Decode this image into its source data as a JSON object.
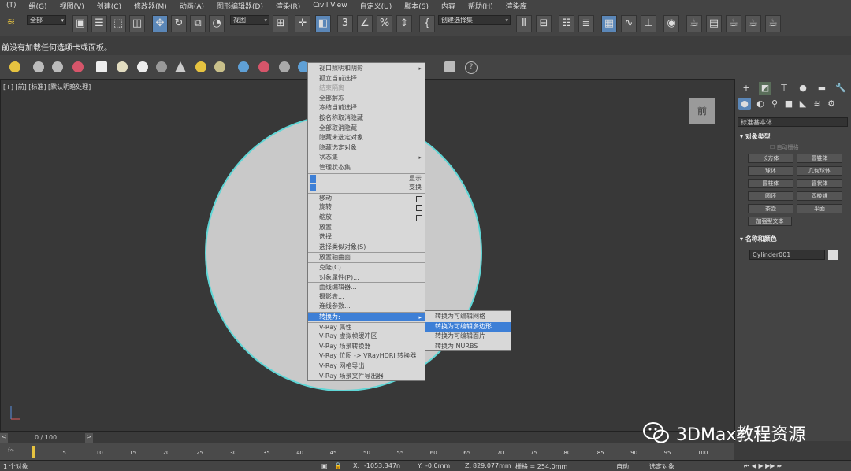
{
  "menubar": [
    "(T)",
    "组(G)",
    "视图(V)",
    "创建(C)",
    "修改器(M)",
    "动画(A)",
    "图形编辑器(D)",
    "渲染(R)",
    "Civil View",
    "自定义(U)",
    "脚本(S)",
    "内容",
    "帮助(H)",
    "渲染库"
  ],
  "toolbar": {
    "selection_filter": "全部",
    "ref_coord": "视图",
    "named_selection": "创建选择集"
  },
  "infobar": {
    "message": "前没有加载任何选项卡或面板。"
  },
  "viewport": {
    "label": "[+] [前] [标准] [默认明暗处理]",
    "viewcube_label": "前"
  },
  "context_menu": {
    "items": [
      {
        "label": "视口照明和阴影",
        "arrow": "▸"
      },
      {
        "label": "孤立当前选择"
      },
      {
        "label": "结束隔离",
        "dim": true
      },
      {
        "label": "全部解冻"
      },
      {
        "label": "冻结当前选择"
      },
      {
        "label": "按名称取消隐藏"
      },
      {
        "label": "全部取消隐藏"
      },
      {
        "label": "隐藏未选定对象"
      },
      {
        "label": "隐藏选定对象"
      },
      {
        "label": "状态集",
        "arrow": "▸"
      },
      {
        "label": "管理状态集..."
      },
      {
        "label": "",
        "right": "显示"
      },
      {
        "label": "",
        "right": "变换"
      },
      {
        "label": "移动"
      },
      {
        "label": "旋转"
      },
      {
        "label": "缩放"
      },
      {
        "label": "放置"
      },
      {
        "label": "选择"
      },
      {
        "label": "选择类似对象(S)"
      },
      {
        "label": "放置轴曲面"
      },
      {
        "label": "克隆(C)"
      },
      {
        "label": "对象属性(P)..."
      },
      {
        "label": "曲线编辑器..."
      },
      {
        "label": "摄影表..."
      },
      {
        "label": "连线参数..."
      },
      {
        "label": "转换为:",
        "arrow": "▸"
      },
      {
        "label": "V-Ray 属性"
      },
      {
        "label": "V-Ray 虚拟帧缓冲区"
      },
      {
        "label": "V-Ray 场景转换器"
      },
      {
        "label": "V-Ray 位图 -> VRayHDRI 转换器"
      },
      {
        "label": "V-Ray 网格导出"
      },
      {
        "label": "V-Ray 场景文件导出器"
      }
    ]
  },
  "submenu": {
    "items": [
      "转换为可编辑网格",
      "转换为可编辑多边形",
      "转换为可编辑面片",
      "转换为 NURBS"
    ]
  },
  "right_panel": {
    "category_dropdown": "标准基本体",
    "object_type_header": "对象类型",
    "autogrid_label": "自动栅格",
    "buttons": [
      "长方体",
      "圆锥体",
      "球体",
      "几何球体",
      "圆柱体",
      "管状体",
      "圆环",
      "四棱锥",
      "茶壶",
      "平面",
      "加强型文本"
    ],
    "name_color_header": "名称和颜色",
    "object_name": "Cylinder001"
  },
  "timeline": {
    "frame_label": "0 / 100",
    "ticks": [
      "5",
      "10",
      "15",
      "20",
      "25",
      "30",
      "35",
      "40",
      "45",
      "50",
      "55",
      "60",
      "65",
      "70",
      "75",
      "80",
      "85",
      "90",
      "95",
      "100"
    ]
  },
  "statusbar": {
    "selection": "1 个对象",
    "x_label": "X:",
    "x_value": "-1053.347n",
    "y_label": "Y:",
    "y_value": "-0.0mm",
    "z_label": "Z:",
    "z_value": "829.077mm",
    "grid": "栅格 = 254.0mm",
    "auto": "自动",
    "sel_obj": "选定对象"
  },
  "watermark": {
    "text": "3DMax教程资源"
  }
}
